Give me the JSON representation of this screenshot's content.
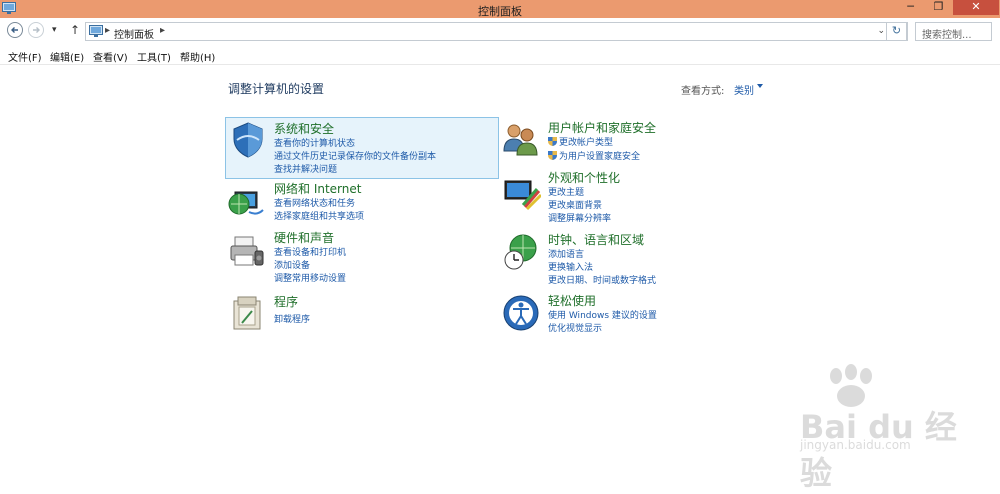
{
  "window": {
    "title": "控制面板",
    "minimize": "─",
    "maximize": "❐",
    "close": "✕"
  },
  "nav": {
    "address_crumb": "控制面板",
    "address_separator": "▸",
    "dropdown_glyph": "⌄",
    "refresh_glyph": "↻",
    "up_glyph": "↑",
    "history_glyph": "▾",
    "search_placeholder": "搜索控制..."
  },
  "menu": {
    "file": "文件(F)",
    "edit": "编辑(E)",
    "view": "查看(V)",
    "tools": "工具(T)",
    "help": "帮助(H)"
  },
  "main": {
    "title": "调整计算机的设置",
    "view_by_label": "查看方式:",
    "view_by_value": "类别"
  },
  "categories": [
    {
      "icon": "shield-system-security-icon",
      "title": "系统和安全",
      "links": [
        "查看你的计算机状态",
        "通过文件历史记录保存你的文件备份副本",
        "查找并解决问题"
      ]
    },
    {
      "icon": "network-globe-icon",
      "title": "网络和 Internet",
      "links": [
        "查看网络状态和任务",
        "选择家庭组和共享选项"
      ]
    },
    {
      "icon": "printer-hardware-icon",
      "title": "硬件和声音",
      "links": [
        "查看设备和打印机",
        "添加设备",
        "调整常用移动设置"
      ]
    },
    {
      "icon": "programs-box-icon",
      "title": "程序",
      "links": [
        "卸载程序"
      ]
    },
    {
      "icon": "users-accounts-icon",
      "title": "用户帐户和家庭安全",
      "links": [
        "更改帐户类型",
        "为用户设置家庭安全"
      ]
    },
    {
      "icon": "appearance-display-icon",
      "title": "外观和个性化",
      "links": [
        "更改主题",
        "更改桌面背景",
        "调整屏幕分辨率"
      ]
    },
    {
      "icon": "clock-globe-icon",
      "title": "时钟、语言和区域",
      "links": [
        "添加语言",
        "更换输入法",
        "更改日期、时间或数字格式"
      ]
    },
    {
      "icon": "ease-of-access-icon",
      "title": "轻松使用",
      "links": [
        "使用 Windows 建议的设置",
        "优化视觉显示"
      ]
    }
  ],
  "watermark": {
    "text": "Bai du 经验",
    "sub": "jingyan.baidu.com"
  },
  "colors": {
    "titlebar": "#eb9a6f",
    "close_button": "#c7503e",
    "category_title": "#1f6f2a",
    "link": "#1e5aa8",
    "selected_bg": "#e6f3fb"
  }
}
